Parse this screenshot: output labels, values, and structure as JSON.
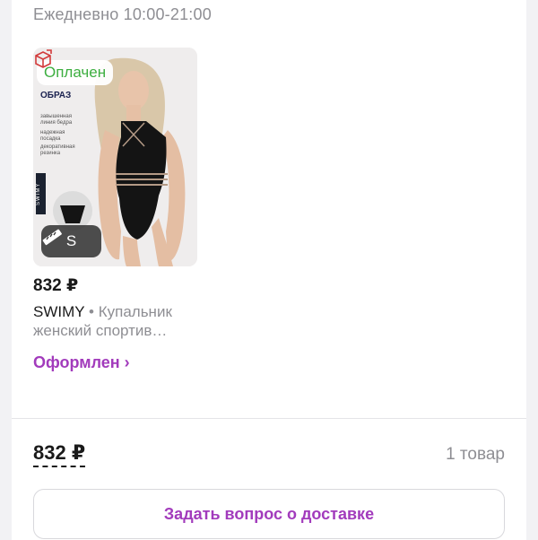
{
  "store": {
    "hours": "Ежедневно 10:00-21:00"
  },
  "order_item": {
    "status_badge": "Оплачен",
    "image_text": {
      "brand_logo": "ОБРАЗ",
      "features": [
        "завышенная линия бедра",
        "надежная посадка",
        "декоративная резинка"
      ],
      "side_tag": "SWIMY"
    },
    "size": "S",
    "price": "832 ₽",
    "brand": "SWIMY",
    "separator": " • ",
    "name": "Купальник женский спортив…",
    "status_link": "Оформлен ›"
  },
  "summary": {
    "total": "832 ₽",
    "count": "1 товар"
  },
  "actions": {
    "ask_delivery": "Задать вопрос о доставке"
  },
  "colors": {
    "accent": "#a23bbc",
    "paid_green": "#3cae3f",
    "muted": "#8e8e93"
  },
  "icons": {
    "return": "box-return-icon",
    "size": "ruler-icon"
  }
}
